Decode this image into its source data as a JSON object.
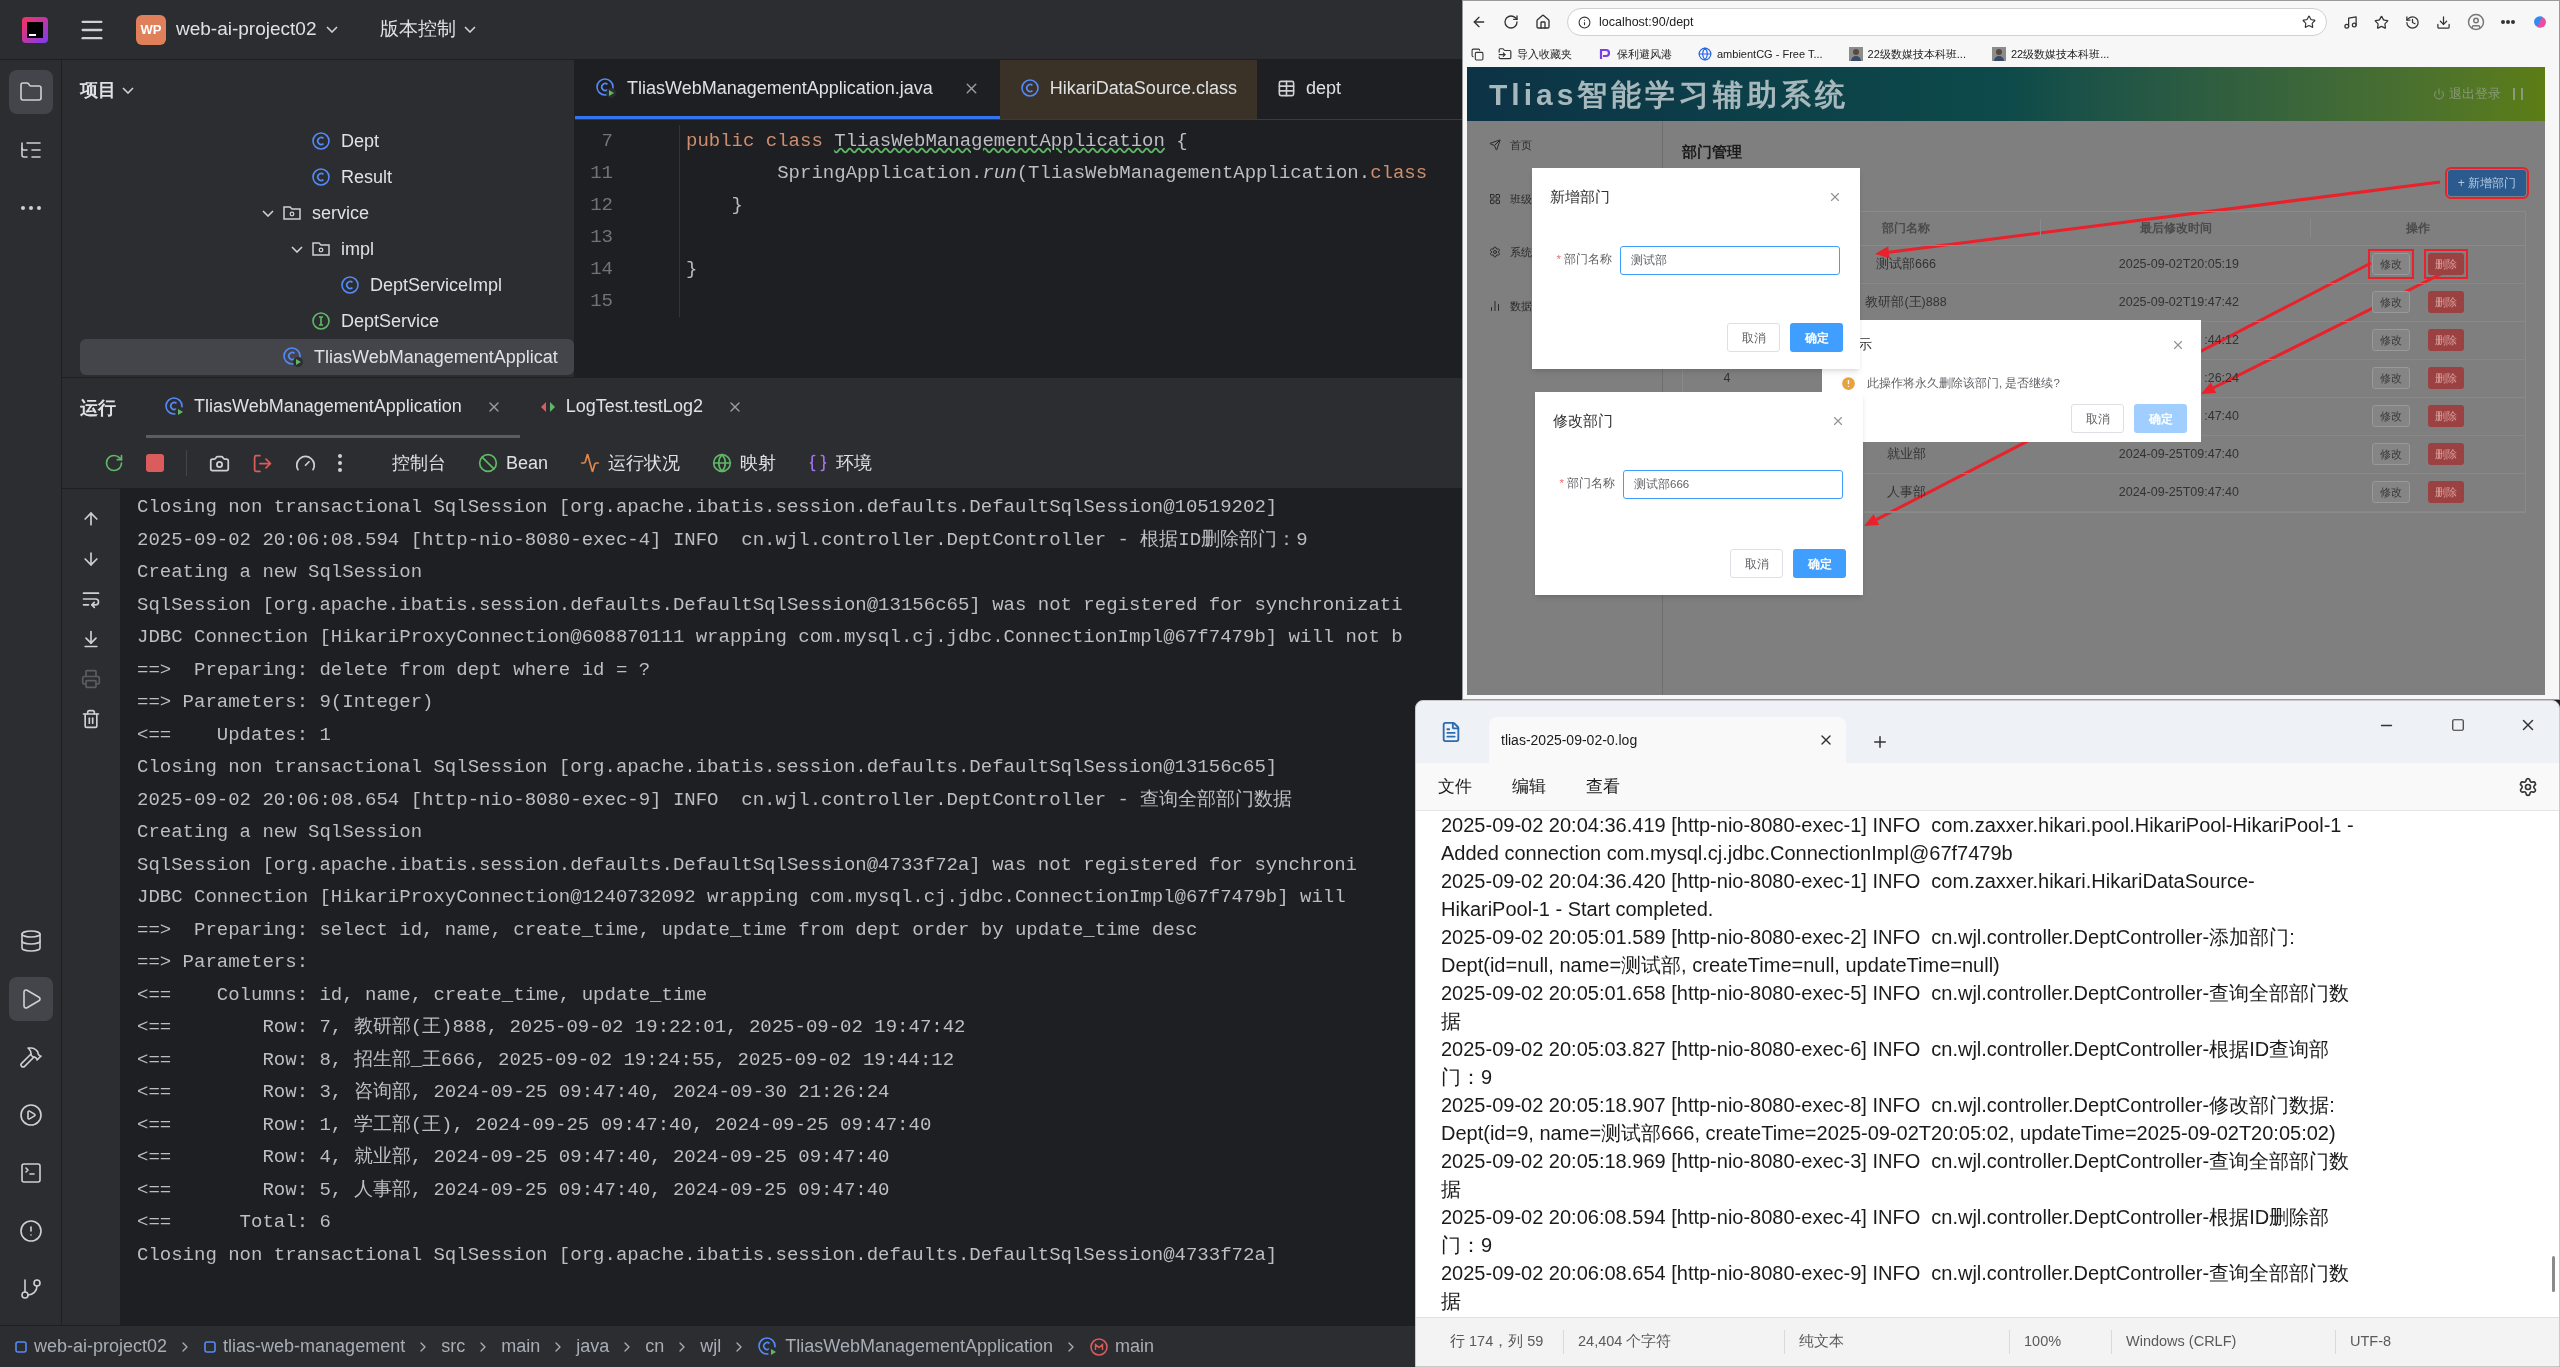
{
  "ide": {
    "project": {
      "badge": "WP",
      "name": "web-ai-project02"
    },
    "vcs_menu": "版本控制",
    "left_toolbar": [
      {
        "kind": "folder",
        "selected": true
      },
      {
        "kind": "structure",
        "selected": false
      },
      {
        "kind": "more",
        "selected": false
      }
    ],
    "left_toolbar_bottom": [
      {
        "kind": "database",
        "selected": false
      },
      {
        "kind": "run",
        "selected": true
      },
      {
        "kind": "build",
        "selected": false
      },
      {
        "kind": "services",
        "selected": false
      },
      {
        "kind": "terminal",
        "selected": false
      },
      {
        "kind": "problems",
        "selected": false
      },
      {
        "kind": "git",
        "selected": false
      }
    ],
    "project_panel": {
      "title": "项目",
      "tree": [
        {
          "children": [
            {
              "label": "Dept",
              "kind": "class",
              "selected": false
            },
            {
              "label": "Result",
              "kind": "class",
              "selected": false
            }
          ]
        },
        {
          "label": "service",
          "kind": "package",
          "expanded": true,
          "selected": false,
          "children": [
            {
              "label": "impl",
              "kind": "package",
              "expanded": true,
              "selected": false,
              "children": [
                {
                  "label": "DeptServiceImpl",
                  "kind": "class",
                  "selected": false
                }
              ]
            },
            {
              "label": "DeptService",
              "kind": "interface",
              "selected": false
            }
          ]
        },
        {
          "label": "TliasWebManagementApplicat",
          "kind": "app",
          "selected": true
        }
      ]
    },
    "editor": {
      "tabs": [
        {
          "label": "TliasWebManagementApplication.java",
          "kind": "app",
          "selected": true
        },
        {
          "label": "HikariDataSource.class",
          "kind": "class",
          "selected": false
        },
        {
          "label": "dept",
          "kind": "table",
          "selected": false
        }
      ],
      "code": [
        {
          "number": "7",
          "tokens": [
            {
              "kind": "keyword",
              "text": "public class "
            },
            {
              "kind": "type",
              "text": "TliasWebManagementApplication"
            },
            {
              "kind": "plain",
              "text": " {"
            }
          ]
        },
        {
          "number": "11",
          "tokens": [
            {
              "kind": "plain",
              "text": "        SpringApplication."
            },
            {
              "kind": "method",
              "text": "run"
            },
            {
              "kind": "plain",
              "text": "(TliasWebManagementApplication."
            },
            {
              "kind": "keyword",
              "text": "class"
            }
          ]
        },
        {
          "number": "12",
          "tokens": [
            {
              "kind": "plain",
              "text": "    }"
            }
          ]
        },
        {
          "number": "13"
        },
        {
          "number": "14",
          "tokens": [
            {
              "kind": "plain",
              "text": "}"
            }
          ]
        },
        {
          "number": "15"
        }
      ]
    },
    "run_panel": {
      "title": "运行",
      "tabs": [
        {
          "label": "TliasWebManagementApplication",
          "kind": "spring",
          "selected": true
        },
        {
          "label": "LogTest.testLog2",
          "kind": "test",
          "selected": false
        }
      ],
      "views": [
        {
          "label": "控制台",
          "kind": "plain"
        },
        {
          "label": "Bean",
          "kind": "bean"
        },
        {
          "label": "运行状况",
          "kind": "health"
        },
        {
          "label": "映射",
          "kind": "mapping"
        },
        {
          "label": "环境",
          "kind": "env"
        }
      ],
      "console": [
        "Closing non transactional SqlSession [org.apache.ibatis.session.defaults.DefaultSqlSession@10519202]",
        "2025-09-02 20:06:08.594 [http-nio-8080-exec-4] INFO  cn.wjl.controller.DeptController - 根据ID删除部门：9",
        "Creating a new SqlSession",
        "SqlSession [org.apache.ibatis.session.defaults.DefaultSqlSession@13156c65] was not registered for synchronizati",
        "JDBC Connection [HikariProxyConnection@608870111 wrapping com.mysql.cj.jdbc.ConnectionImpl@67f7479b] will not b",
        "==>  Preparing: delete from dept where id = ?",
        "==> Parameters: 9(Integer)",
        "<==    Updates: 1",
        "Closing non transactional SqlSession [org.apache.ibatis.session.defaults.DefaultSqlSession@13156c65]",
        "2025-09-02 20:06:08.654 [http-nio-8080-exec-9] INFO  cn.wjl.controller.DeptController - 查询全部部门数据",
        "Creating a new SqlSession",
        "SqlSession [org.apache.ibatis.session.defaults.DefaultSqlSession@4733f72a] was not registered for synchroni",
        "JDBC Connection [HikariProxyConnection@1240732092 wrapping com.mysql.cj.jdbc.ConnectionImpl@67f7479b] will",
        "==>  Preparing: select id, name, create_time, update_time from dept order by update_time desc",
        "==> Parameters: ",
        "<==    Columns: id, name, create_time, update_time",
        "<==        Row: 7, 教研部(王)888, 2025-09-02 19:22:01, 2025-09-02 19:47:42",
        "<==        Row: 8, 招生部_王666, 2025-09-02 19:24:55, 2025-09-02 19:44:12",
        "<==        Row: 3, 咨询部, 2024-09-25 09:47:40, 2024-09-30 21:26:24",
        "<==        Row: 1, 学工部(王), 2024-09-25 09:47:40, 2024-09-25 09:47:40",
        "<==        Row: 4, 就业部, 2024-09-25 09:47:40, 2024-09-25 09:47:40",
        "<==        Row: 5, 人事部, 2024-09-25 09:47:40, 2024-09-25 09:47:40",
        "<==      Total: 6",
        "Closing non transactional SqlSession [org.apache.ibatis.session.defaults.DefaultSqlSession@4733f72a]"
      ]
    },
    "breadcrumbs": [
      {
        "label": "web-ai-project02",
        "kind": "module"
      },
      {
        "label": "tlias-web-management",
        "kind": "module"
      },
      {
        "label": "src",
        "kind": "directory"
      },
      {
        "label": "main",
        "kind": "directory"
      },
      {
        "label": "java",
        "kind": "directory"
      },
      {
        "label": "cn",
        "kind": "directory"
      },
      {
        "label": "wjl",
        "kind": "directory"
      },
      {
        "label": "TliasWebManagementApplication",
        "kind": "app"
      },
      {
        "label": "main",
        "kind": "method"
      }
    ]
  },
  "browser": {
    "url": "localhost:90/dept",
    "bookmarks": [
      {
        "label": "导入收藏夹",
        "kind": "import"
      },
      {
        "label": "保利避风港",
        "kind": "site"
      },
      {
        "label": "ambientCG - Free T...",
        "kind": "web"
      },
      {
        "label": "22级数媒技本科班...",
        "kind": "profile"
      },
      {
        "label": "22级数媒技本科班...",
        "kind": "profile"
      }
    ],
    "app": {
      "title": "Tlias智能学习辅助系统",
      "logout": "退出登录",
      "menu": [
        {
          "label": "首页",
          "kind": "home"
        },
        {
          "label": "班级",
          "kind": "classes"
        },
        {
          "label": "系统",
          "kind": "system"
        },
        {
          "label": "数据",
          "kind": "stats"
        }
      ],
      "page_title": "部门管理",
      "add_button": {
        "label": "+ 新增部门",
        "highlighted": true
      },
      "table": {
        "columns": [
          "部门名称",
          "最后修改时间",
          "操作"
        ],
        "rows": [
          {
            "name": "测试部666",
            "time": "2025-09-02T20:05:19",
            "edit": "修改",
            "delete": "删除",
            "highlighted": true
          },
          {
            "name": "教研部(王)888",
            "time": "2025-09-02T19:47:42",
            "edit": "修改",
            "delete": "删除",
            "highlighted": false
          },
          {
            "time": ":44:12",
            "edit": "修改",
            "delete": "删除",
            "highlighted": false
          },
          {
            "index": "4",
            "time": ":26:24",
            "edit": "修改",
            "delete": "删除",
            "highlighted": false
          },
          {
            "time": ":47:40",
            "edit": "修改",
            "delete": "删除",
            "highlighted": false
          },
          {
            "name": "就业部",
            "time": "2024-09-25T09:47:40",
            "edit": "修改",
            "delete": "删除",
            "highlighted": false
          },
          {
            "name": "人事部",
            "time": "2024-09-25T09:47:40",
            "edit": "修改",
            "delete": "删除",
            "highlighted": false
          }
        ]
      },
      "confirm_dialog": {
        "title": "示",
        "message": "此操作将永久删除该部门, 是否继续?",
        "cancel": "取消",
        "confirm": "确定"
      },
      "add_dialog": {
        "title": "新增部门",
        "required_mark": "*",
        "label": "部门名称",
        "value": "测试部",
        "cancel": "取消",
        "confirm": "确定"
      },
      "edit_dialog": {
        "title": "修改部门",
        "required_mark": "*",
        "label": "部门名称",
        "value": "测试部666",
        "cancel": "取消",
        "confirm": "确定"
      }
    }
  },
  "notepad": {
    "tab": "tlias-2025-09-02-0.log",
    "menu": [
      "文件",
      "编辑",
      "查看"
    ],
    "lines": [
      "2025-09-02 20:04:36.419 [http-nio-8080-exec-1] INFO  com.zaxxer.hikari.pool.HikariPool-HikariPool-1 -",
      "Added connection com.mysql.cj.jdbc.ConnectionImpl@67f7479b",
      "2025-09-02 20:04:36.420 [http-nio-8080-exec-1] INFO  com.zaxxer.hikari.HikariDataSource-",
      "HikariPool-1 - Start completed.",
      "2025-09-02 20:05:01.589 [http-nio-8080-exec-2] INFO  cn.wjl.controller.DeptController-添加部门:",
      "Dept(id=null, name=测试部, createTime=null, updateTime=null)",
      "2025-09-02 20:05:01.658 [http-nio-8080-exec-5] INFO  cn.wjl.controller.DeptController-查询全部部门数",
      "据",
      "2025-09-02 20:05:03.827 [http-nio-8080-exec-6] INFO  cn.wjl.controller.DeptController-根据ID查询部",
      "门：9",
      "2025-09-02 20:05:18.907 [http-nio-8080-exec-8] INFO  cn.wjl.controller.DeptController-修改部门数据:",
      "Dept(id=9, name=测试部666, createTime=2025-09-02T20:05:02, updateTime=2025-09-02T20:05:02)",
      "2025-09-02 20:05:18.969 [http-nio-8080-exec-3] INFO  cn.wjl.controller.DeptController-查询全部部门数",
      "据",
      "2025-09-02 20:06:08.594 [http-nio-8080-exec-4] INFO  cn.wjl.controller.DeptController-根据ID删除部",
      "门：9",
      "2025-09-02 20:06:08.654 [http-nio-8080-exec-9] INFO  cn.wjl.controller.DeptController-查询全部部门数",
      "据"
    ],
    "status": [
      "行 174，列 59",
      "24,404 个字符",
      "纯文本",
      "100%",
      "Windows (CRLF)",
      "UTF-8"
    ]
  }
}
